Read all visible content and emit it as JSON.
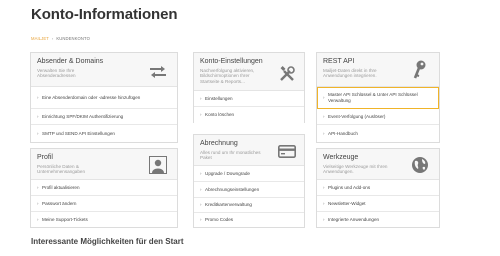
{
  "page": {
    "title": "Konto-Informationen",
    "section_heading": "Interessante Möglichkeiten für den Start"
  },
  "breadcrumb": {
    "items": [
      {
        "label": "MAILJET"
      },
      {
        "label": "KUNDENKONTO"
      }
    ],
    "separator": "›"
  },
  "colors": {
    "accent": "#e8a43c",
    "highlight_border": "#f0b429",
    "card_head_bg": "#f7f7f7",
    "card_border": "#dcdcdc"
  },
  "cards": {
    "absender": {
      "title": "Absender & Domains",
      "desc": "Verwalten Sie Ihre Absenderadressen",
      "icon": "arrows-exchange-icon",
      "links": [
        "Eine Absenderdomain oder -adresse hinzufügen",
        "Einrichtung SPF/DKIM Authentifizierung",
        "SMTP und SEND API Einstellungen"
      ]
    },
    "konto": {
      "title": "Konto-Einstellungen",
      "desc": "Nachverfolgung aktivieren, Bildschirmoptionen Ihrer Startseite & Reports...",
      "icon": "tools-icon",
      "links": [
        "Einstellungen",
        "Konto löschen"
      ]
    },
    "rest": {
      "title": "REST API",
      "desc": "Mailjet-Daten direkt in Ihre Anwendungen integrieren.",
      "icon": "key-icon",
      "links": [
        "Master API Schlüssel & Unter API Schlüssel Verwaltung",
        "Event-Verfolgung (Auslöser)",
        "API-Handbuch"
      ]
    },
    "profil": {
      "title": "Profil",
      "desc": "Persönliche Daten & Unternehmensangaben",
      "icon": "user-icon",
      "links": [
        "Profil aktualisieren",
        "Passwort ändern",
        "Meine Support-Tickets"
      ]
    },
    "abrechnung": {
      "title": "Abrechnung",
      "desc": "Alles rund um Ihr monatliches Paket",
      "icon": "credit-card-icon",
      "links": [
        "Upgrade / Downgrade",
        "Abrechnungseinstellungen",
        "Kreditkartenverwaltung",
        "Promo Codes"
      ]
    },
    "werkzeuge": {
      "title": "Werkzeuge",
      "desc": "Vielseitige Werkzeuge mit Ihren Anwendungen.",
      "icon": "globe-icon",
      "links": [
        "Plugins und Add-ons",
        "Newsletter-Widget",
        "Integrierte Anwendungen"
      ]
    }
  }
}
